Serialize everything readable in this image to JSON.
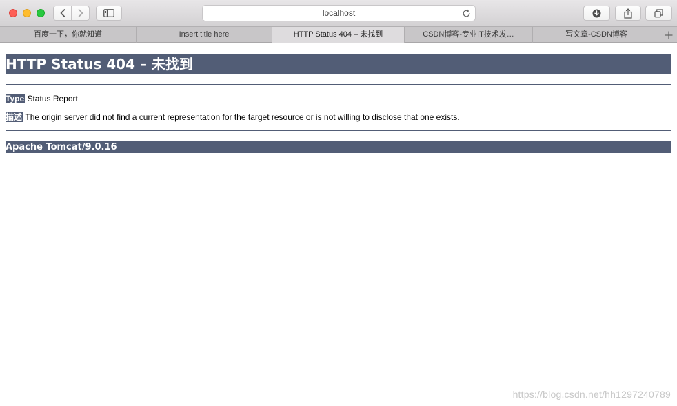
{
  "browser": {
    "address": {
      "url": "localhost"
    },
    "tabs": [
      {
        "label": "百度一下，你就知道",
        "active": false
      },
      {
        "label": "Insert title here",
        "active": false
      },
      {
        "label": "HTTP Status 404 – 未找到",
        "active": true
      },
      {
        "label": "CSDN博客-专业IT技术发…",
        "active": false
      },
      {
        "label": "写文章-CSDN博客",
        "active": false
      }
    ],
    "icons": {
      "back": "chevron-left-icon",
      "forward": "chevron-right-icon",
      "sidebar": "sidebar-icon",
      "reload": "reload-icon",
      "downloads": "download-icon",
      "share": "share-icon",
      "tabs_overview": "tabs-overview-icon",
      "new_tab": "plus-icon"
    }
  },
  "page": {
    "title": "HTTP Status 404 – 未找到",
    "type_label": "Type",
    "type_value": "Status Report",
    "description_label": "描述",
    "description_value": "The origin server did not find a current representation for the target resource or is not willing to disclose that one exists.",
    "footer": "Apache Tomcat/9.0.16",
    "watermark": "https://blog.csdn.net/hh1297240789"
  },
  "colors": {
    "tomcat_header": "#525d76",
    "close": "#fe5f57",
    "minimize": "#febc2e",
    "maximize": "#28c840"
  }
}
